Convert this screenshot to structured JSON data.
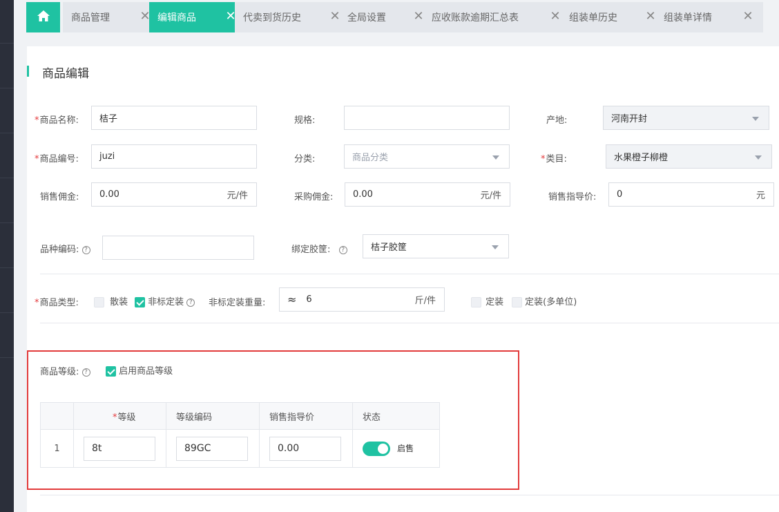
{
  "tabs": [
    {
      "label": "",
      "icon": "home-icon"
    },
    {
      "label": "商品管理"
    },
    {
      "label": "编辑商品"
    },
    {
      "label": "代卖到货历史"
    },
    {
      "label": "全局设置"
    },
    {
      "label": "应收账款逾期汇总表"
    },
    {
      "label": "组装单历史"
    },
    {
      "label": "组装单详情"
    }
  ],
  "tab_close_glyph": "✕",
  "page": {
    "title": "商品编辑"
  },
  "form": {
    "name_label": "商品名称:",
    "name_value": "桔子",
    "spec_label": "规格:",
    "spec_value": "",
    "origin_label": "产地:",
    "origin_value": "河南开封",
    "code_label": "商品编号:",
    "code_value": "juzi",
    "category_label": "分类:",
    "category_placeholder": "商品分类",
    "subcategory_label": "类目:",
    "subcategory_value": "水果橙子柳橙",
    "sales_commission_label": "销售佣金:",
    "sales_commission_value": "0.00",
    "sales_commission_unit": "元/件",
    "purchase_commission_label": "采购佣金:",
    "purchase_commission_value": "0.00",
    "purchase_commission_unit": "元/件",
    "guide_price_label": "销售指导价:",
    "guide_price_value": "0",
    "guide_price_unit": "元",
    "variety_code_label": "品种编码:",
    "variety_code_value": "",
    "crate_label": "绑定胶筐:",
    "crate_value": "桔子胶筐",
    "type_label": "商品类型:",
    "type_bulk": "散装",
    "type_nonstandard": "非标定装",
    "nonstandard_weight_label": "非标定装重量:",
    "weight_prefix": "≈",
    "weight_value": "6",
    "weight_unit": "斤/件",
    "type_fixed": "定装",
    "type_fixed_multi": "定装(多单位)",
    "grade_label": "商品等级:",
    "grade_enable_label": "启用商品等级",
    "help_glyph": "?"
  },
  "grade_table": {
    "headers": [
      "",
      "等级",
      "等级编码",
      "销售指导价",
      "状态"
    ],
    "rows": [
      {
        "index": "1",
        "grade": "8t",
        "code": "89GC",
        "price": "0.00",
        "status": "启售"
      }
    ]
  },
  "colors": {
    "accent": "#1fc2a2",
    "highlight_box": "#e23a3a",
    "required": "#e4393c"
  }
}
